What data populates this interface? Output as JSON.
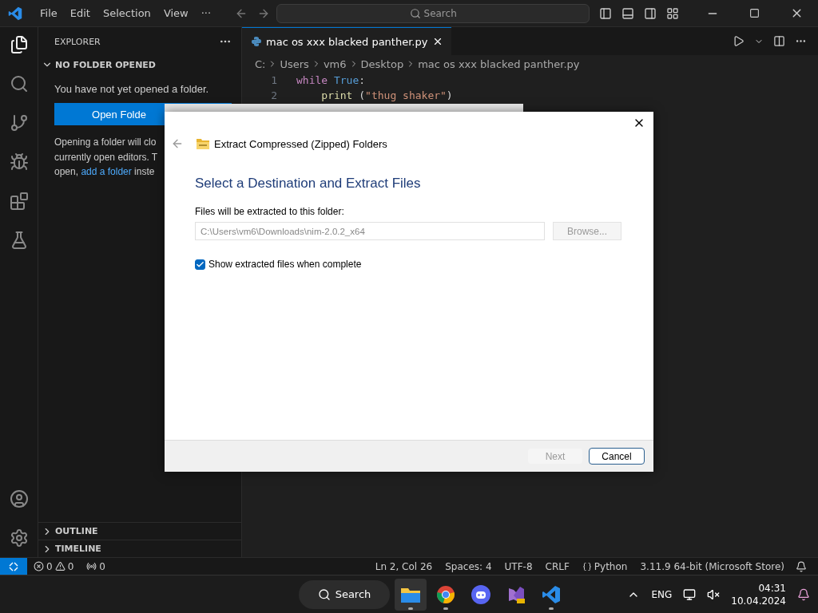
{
  "title_bar": {
    "menu": [
      "File",
      "Edit",
      "Selection",
      "View",
      "···"
    ],
    "search": {
      "placeholder": "Search"
    }
  },
  "sidebar": {
    "title": "EXPLORER",
    "section": {
      "title": "NO FOLDER OPENED",
      "expanded": true
    },
    "message": "You have not yet opened a folder.",
    "button": "Open Folde",
    "note_lines": [
      "Opening a folder will clo",
      "currently open editors. T"
    ],
    "note_last": {
      "prefix": "open, ",
      "link": "add a folder",
      "suffix": " inste"
    },
    "panels": [
      {
        "title": "OUTLINE",
        "expanded": false
      },
      {
        "title": "TIMELINE",
        "expanded": false
      }
    ]
  },
  "editor": {
    "tabs": [
      {
        "label": "mac os xxx blacked panther.py",
        "selected": true
      }
    ],
    "breadcrumbs": [
      "C:",
      "Users",
      "vm6",
      "Desktop",
      "mac os xxx blacked panther.py"
    ],
    "lines": [
      {
        "number": "1",
        "tokens": [
          {
            "kind": "keyword",
            "text": "while"
          },
          {
            "kind": "constant",
            "text": " True"
          },
          {
            "kind": "punct",
            "text": ":"
          }
        ]
      },
      {
        "number": "2",
        "tokens": [
          {
            "kind": "func",
            "text": "    print"
          },
          {
            "kind": "punct",
            "text": " ("
          },
          {
            "kind": "string",
            "text": "\"thug shaker\""
          },
          {
            "kind": "punct",
            "text": ")"
          }
        ]
      }
    ]
  },
  "status_bar": {
    "errors": "0",
    "warnings": "0",
    "ports": "0",
    "items": [
      {
        "kind": "text",
        "text": "Ln 2, Col 26"
      },
      {
        "kind": "text",
        "text": "Spaces: 4"
      },
      {
        "kind": "text",
        "text": "UTF-8"
      },
      {
        "kind": "text",
        "text": "CRLF"
      },
      {
        "kind": "language",
        "text": "Python"
      },
      {
        "kind": "text",
        "text": "3.11.9 64-bit (Microsoft Store)"
      }
    ]
  },
  "dialog": {
    "title": "Extract Compressed (Zipped) Folders",
    "heading": "Select a Destination and Extract Files",
    "field_label": "Files will be extracted to this folder:",
    "path": "C:\\Users\\vm6\\Downloads\\nim-2.0.2_x64",
    "browse": {
      "label": "Browse...",
      "disabled": true
    },
    "show_files": {
      "label": "Show extracted files when complete",
      "checked": true
    },
    "buttons": [
      {
        "label": "Next",
        "disabled": true
      },
      {
        "label": "Cancel",
        "disabled": false
      }
    ]
  },
  "taskbar": {
    "search": "Search",
    "apps": [
      {
        "kind": "explorer",
        "running": true,
        "active": true
      },
      {
        "kind": "chrome",
        "running": true,
        "active": false
      },
      {
        "kind": "discord",
        "running": false,
        "active": false
      },
      {
        "kind": "vs",
        "running": false,
        "active": false
      },
      {
        "kind": "vscode",
        "running": true,
        "active": false
      }
    ],
    "language": "ENG",
    "time": "04:31",
    "date": "10.04.2024"
  }
}
